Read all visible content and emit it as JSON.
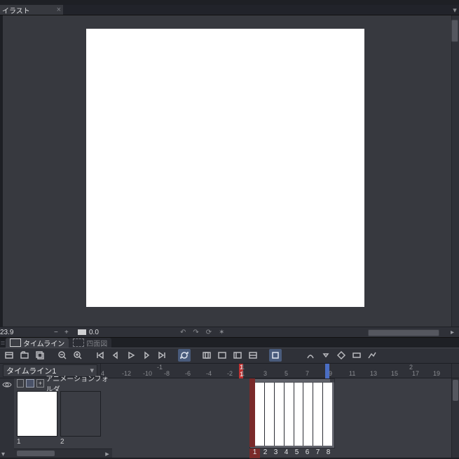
{
  "document": {
    "tab_title": "イラスト",
    "close_glyph": "×",
    "dropdown_glyph": "▾"
  },
  "status": {
    "left_value": "23.9",
    "minus": "−",
    "plus": "+",
    "mid_value": "0.0",
    "undo_glyph": "↶",
    "redo_glyph": "↷",
    "sync_glyph": "⟳",
    "at_glyph": "✶",
    "right_arrow": "▸"
  },
  "panel": {
    "handle_glyph": "≡",
    "tab_active": "タイムライン",
    "tab_inactive": "四面図"
  },
  "timeline": {
    "select_value": "タイムライン1",
    "caret": "▾",
    "ruler_top": [
      "-1",
      "1",
      "2"
    ],
    "ruler_top_pos": [
      80,
      200,
      440
    ],
    "ruler": [
      "4",
      "-12",
      "-10",
      "-8",
      "-6",
      "-4",
      "-2",
      "1",
      "3",
      "5",
      "7",
      "9",
      "11",
      "13",
      "15",
      "17",
      "19"
    ],
    "ruler_pos": [
      0,
      30,
      60,
      90,
      120,
      150,
      180,
      200,
      232,
      262,
      292,
      325,
      354,
      384,
      414,
      444,
      474
    ],
    "playhead_frame": "1",
    "playhead_sub": "1"
  },
  "tracks": {
    "folder_plus": "+",
    "folder_label": "アニメーションフォルダ",
    "cel_numbers": [
      "1",
      "2"
    ],
    "frame_numbers": [
      "1",
      "2",
      "3",
      "4",
      "5",
      "6",
      "7",
      "8"
    ],
    "scroll_right": "▸",
    "bottom_arrow": "▾"
  }
}
